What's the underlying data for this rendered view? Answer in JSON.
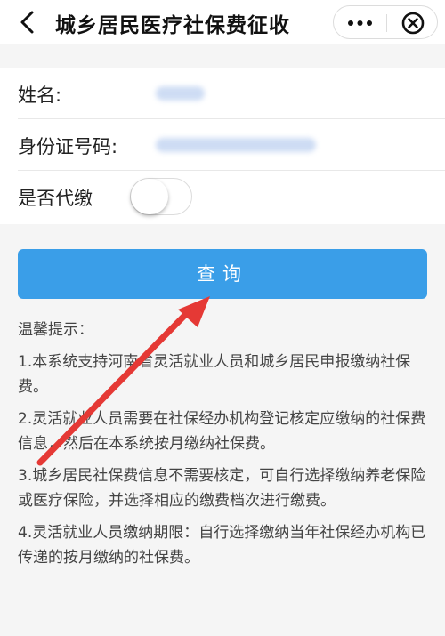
{
  "header": {
    "title": "城乡居民医疗社保费征收",
    "back_icon": "chevron-left-icon",
    "more_icon": "more-dots-icon",
    "close_icon": "close-circle-icon"
  },
  "form": {
    "name_label": "姓名:",
    "id_label": "身份证号码:",
    "proxy_label": "是否代缴",
    "proxy_enabled": false
  },
  "query_button": {
    "label": "查询"
  },
  "tips": {
    "title": "温馨提示：",
    "items": [
      "1.本系统支持河南省灵活就业人员和城乡居民申报缴纳社保费。",
      "2.灵活就业人员需要在社保经办机构登记核定应缴纳的社保费信息，然后在本系统按月缴纳社保费。",
      "3.城乡居民社保费信息不需要核定，可自行选择缴纳养老保险或医疗保险，并选择相应的缴费档次进行缴费。",
      "4.灵活就业人员缴纳期限：自行选择缴纳当年社保经办机构已传递的按月缴纳的社保费。"
    ]
  },
  "colors": {
    "primary": "#3a9ee8",
    "annotation_arrow": "#e53935"
  }
}
